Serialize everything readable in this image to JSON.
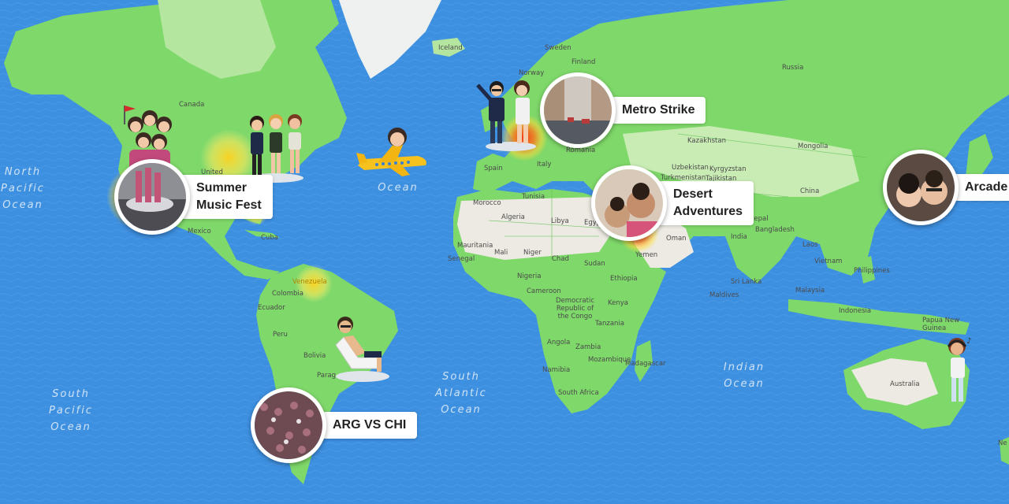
{
  "oceans": {
    "north_pacific": "North\nPacific\nOcean",
    "atlantic": "Ocean",
    "south_pacific": "South\nPacific\nOcean",
    "south_atlantic": "South\nAtlantic\nOcean",
    "indian": "Indian\nOcean"
  },
  "places": {
    "iceland": "Iceland",
    "sweden": "Sweden",
    "finland": "Finland",
    "norway": "Norway",
    "russia": "Russia",
    "canada": "Canada",
    "united": "United",
    "mexico": "Mexico",
    "cuba": "Cuba",
    "venezuela": "Venezuela",
    "colombia": "Colombia",
    "ecuador": "Ecuador",
    "peru": "Peru",
    "bolivia": "Bolivia",
    "paraguay": "Parag",
    "spain": "Spain",
    "italy": "Italy",
    "romania": "Romania",
    "kazakhstan": "Kazakhstan",
    "mongolia": "Mongolia",
    "uzbekistan": "Uzbekistan",
    "kyrgyzstan": "Kyrgyzstan",
    "turkmenistan": "Turkmenistan",
    "tajikistan": "Tajikistan",
    "china": "China",
    "india": "India",
    "nepal": "Nepal",
    "bangladesh": "Bangladesh",
    "laos": "Laos",
    "vietnam": "Vietnam",
    "philippines": "Philippines",
    "sri_lanka": "Sri Lanka",
    "maldives": "Maldives",
    "malaysia": "Malaysia",
    "indonesia": "Indonesia",
    "papua": "Papua New\nGuinea",
    "australia": "Australia",
    "oman": "Oman",
    "yemen": "Yemen",
    "egypt": "Egyp",
    "tunisia": "Tunisia",
    "morocco": "Morocco",
    "algeria": "Algeria",
    "libya": "Libya",
    "mauritania": "Mauritania",
    "mali": "Mali",
    "niger": "Niger",
    "chad": "Chad",
    "sudan": "Sudan",
    "senegal": "Senegal",
    "nigeria": "Nigeria",
    "ethiopia": "Ethiopia",
    "cameroon": "Cameroon",
    "drc": "Democratic\nRepublic of\nthe Congo",
    "kenya": "Kenya",
    "tanzania": "Tanzania",
    "angola": "Angola",
    "zambia": "Zambia",
    "mozambique": "Mozambique",
    "madagascar": "Madagascar",
    "namibia": "Namibia",
    "south_africa": "South Africa",
    "new_zealand": "Ne"
  },
  "stories": [
    {
      "label": "Summer\nMusic Fest",
      "thumb": "crowd-stage"
    },
    {
      "label": "Metro Strike",
      "thumb": "street"
    },
    {
      "label": "Desert\nAdventures",
      "thumb": "selfie"
    },
    {
      "label": "Arcade R",
      "thumb": "couple"
    },
    {
      "label": "ARG VS CHI",
      "thumb": "stadium"
    }
  ],
  "colors": {
    "ocean": "#3d8fe0",
    "land": "#7fd86a",
    "land_light": "#b5e6a0",
    "snow": "#eef1f0",
    "desert": "#eceae2",
    "label_card": "#ffffff",
    "heat_hot": "#e8321a",
    "heat_warm": "#ffe23c"
  }
}
